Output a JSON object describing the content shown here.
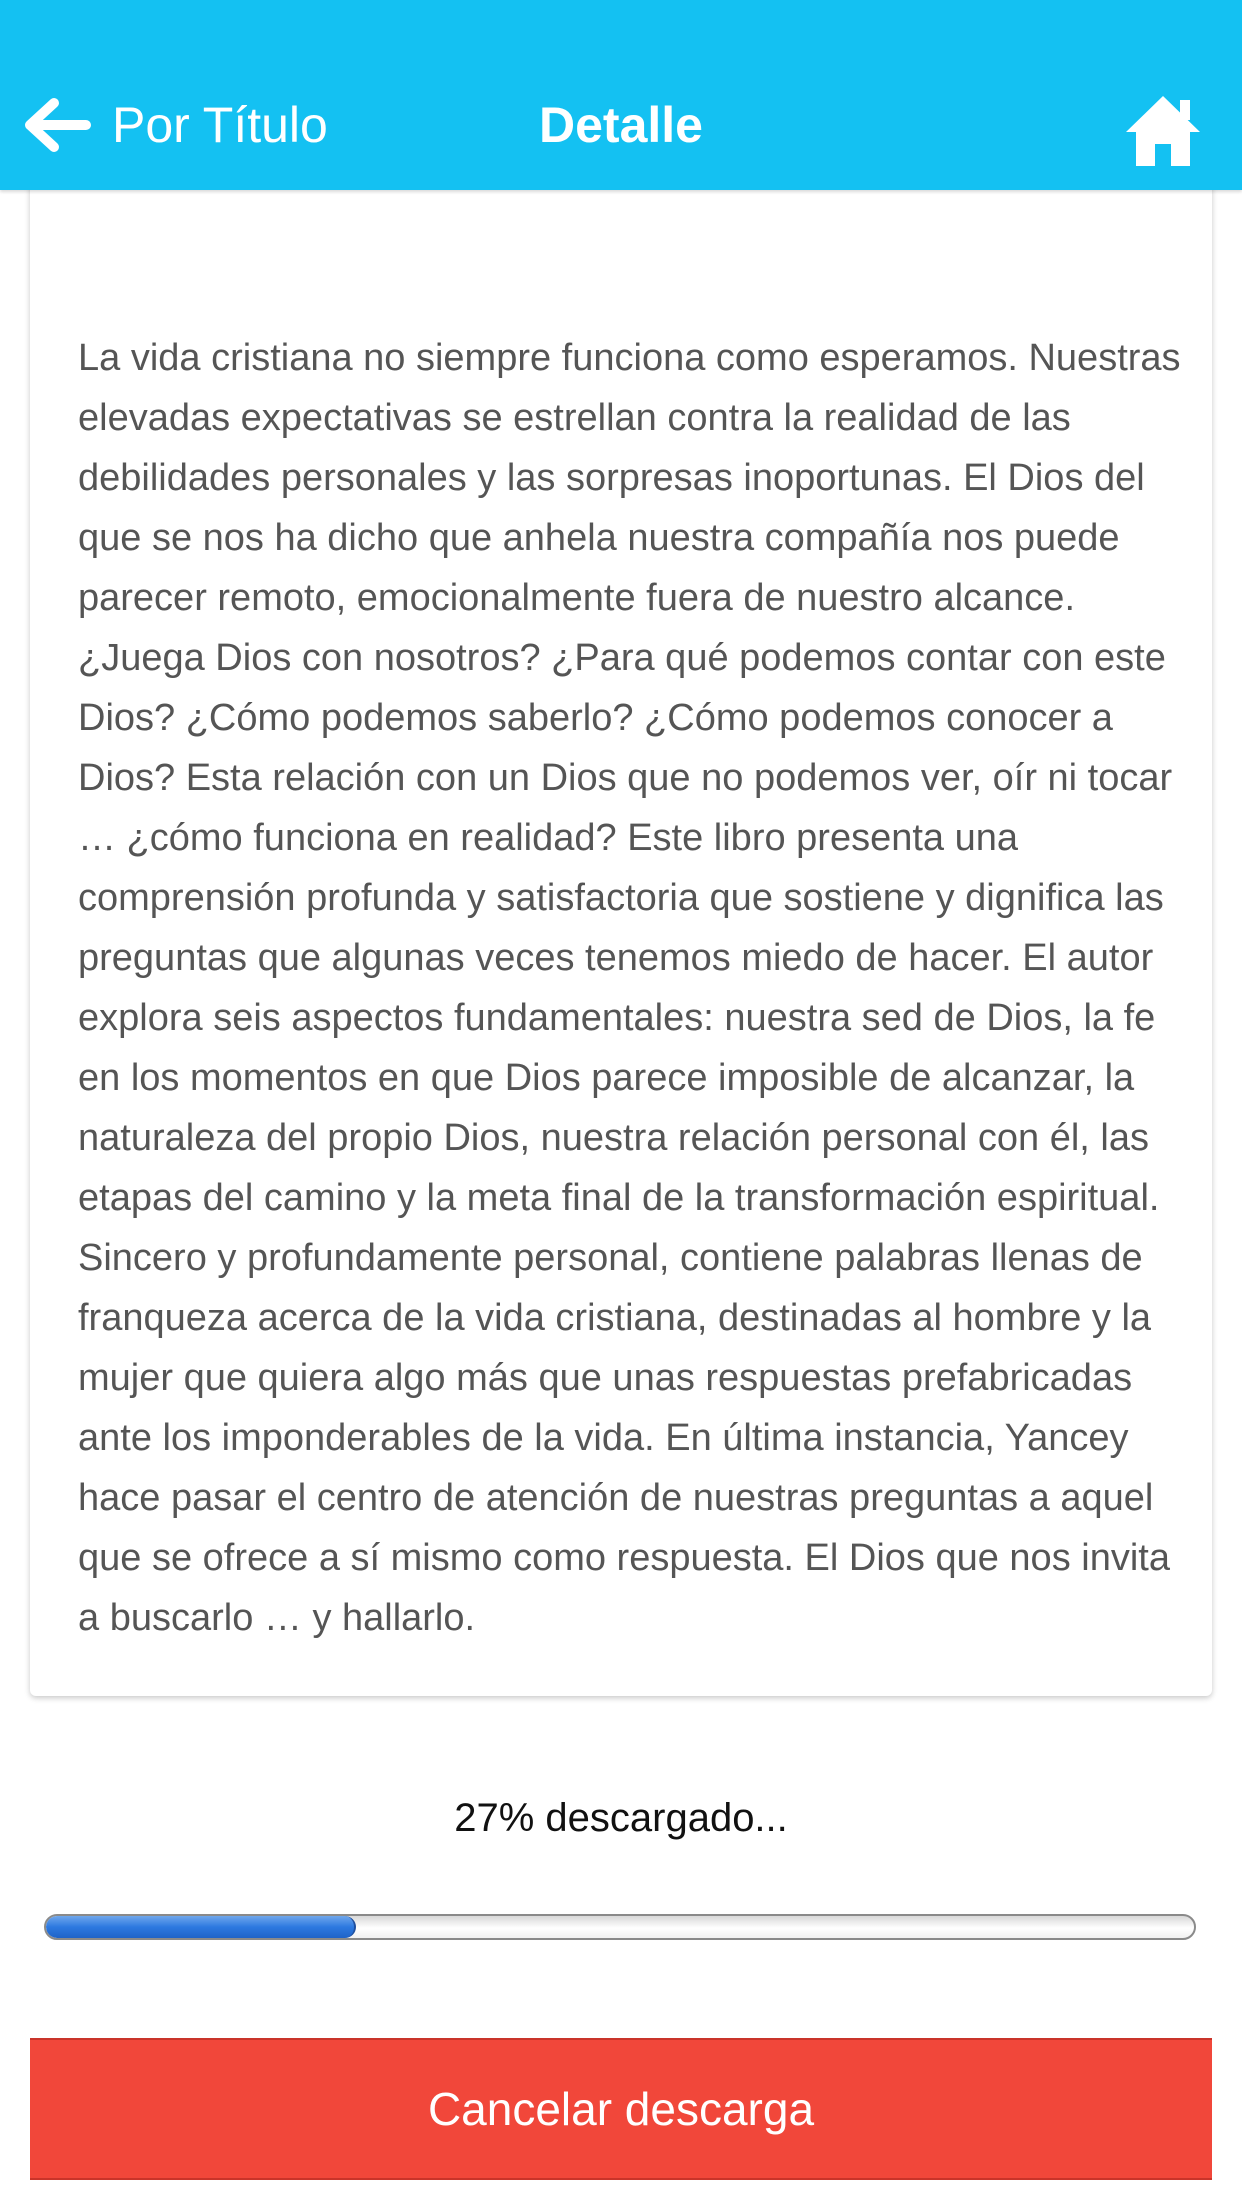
{
  "navbar": {
    "back_label": "Por Título",
    "title": "Detalle",
    "back_icon": "arrow-left-icon",
    "home_icon": "home-icon",
    "background_color": "#14c1f2"
  },
  "description": {
    "text": "La vida cristiana no siempre funciona como esperamos. Nuestras elevadas expectativas se estrellan contra la realidad de las debilidades personales y las sorpresas inoportunas. El Dios del que se nos ha dicho que anhela nuestra compañía nos puede parecer remoto, emocionalmente fuera de nuestro alcance. ¿Juega Dios con nosotros? ¿Para qué podemos contar con este Dios? ¿Cómo podemos saberlo? ¿Cómo podemos conocer a Dios? Esta relación con un Dios que no podemos ver, oír ni tocar … ¿cómo funciona en realidad? Este libro presenta una comprensión profunda y satisfactoria que sostiene y dignifica las preguntas que algunas veces tenemos miedo de hacer. El autor explora seis aspectos fundamentales: nuestra sed de Dios, la fe en los momentos en que Dios parece imposible de alcanzar, la naturaleza del propio Dios, nuestra relación personal con él, las etapas del camino y la meta final de la transformación espiritual. Sincero y profundamente personal, contiene palabras llenas de franqueza acerca de la vida cristiana, destinadas al hombre y la mujer que quiera algo más que unas respuestas prefabricadas ante los imponderables de la vida. En última instancia, Yancey hace pasar el centro de atención de nuestras preguntas a aquel que se ofrece a sí mismo como respuesta. El Dios que nos invita a buscarlo … y hallarlo."
  },
  "download": {
    "status_text": "27% descargado...",
    "progress": 0.27,
    "cancel_label": "Cancelar descarga",
    "cancel_color": "#f1473a"
  }
}
